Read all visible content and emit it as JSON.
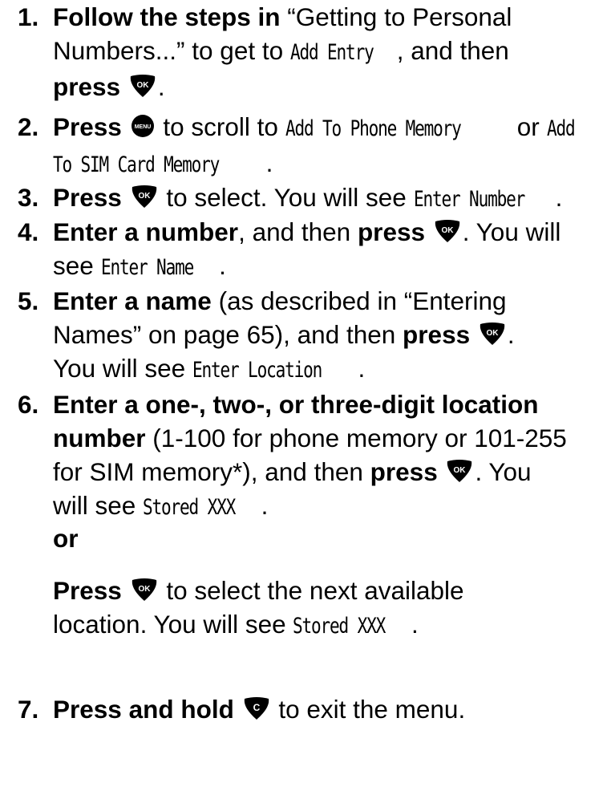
{
  "steps": [
    {
      "number": "1.",
      "lines": [
        [
          {
            "t": "bold",
            "v": "Follow the steps in"
          },
          {
            "t": "text",
            "v": " “Getting to Personal"
          }
        ],
        [
          {
            "t": "text",
            "v": "Numbers...” to get to "
          },
          {
            "t": "lcd",
            "v": "Add Entry"
          },
          {
            "t": "text",
            "v": ", and then"
          }
        ],
        [
          {
            "t": "bold",
            "v": "press "
          },
          {
            "t": "key",
            "v": "ok"
          },
          {
            "t": "text",
            "v": "."
          }
        ]
      ]
    },
    {
      "number": "2.",
      "lines": [
        [
          {
            "t": "bold",
            "v": "Press "
          },
          {
            "t": "key",
            "v": "menu"
          },
          {
            "t": "text",
            "v": " to scroll to "
          },
          {
            "t": "lcd",
            "v": "Add To Phone Memory"
          },
          {
            "t": "text",
            "v": " or "
          },
          {
            "t": "lcd",
            "v": "Add"
          }
        ],
        [
          {
            "t": "lcd",
            "v": "To SIM Card Memory"
          },
          {
            "t": "text",
            "v": "."
          }
        ]
      ]
    },
    {
      "number": "3.",
      "lines": [
        [
          {
            "t": "bold",
            "v": "Press "
          },
          {
            "t": "key",
            "v": "ok"
          },
          {
            "t": "text",
            "v": " to select. You will see "
          },
          {
            "t": "lcd",
            "v": "Enter Number"
          },
          {
            "t": "text",
            "v": "."
          }
        ]
      ]
    },
    {
      "number": "4.",
      "lines": [
        [
          {
            "t": "bold",
            "v": "Enter a number"
          },
          {
            "t": "text",
            "v": ", and then "
          },
          {
            "t": "bold",
            "v": "press "
          },
          {
            "t": "key",
            "v": "ok"
          },
          {
            "t": "text",
            "v": ". You will"
          }
        ],
        [
          {
            "t": "text",
            "v": "see "
          },
          {
            "t": "lcd",
            "v": "Enter Name"
          },
          {
            "t": "text",
            "v": "."
          }
        ]
      ]
    },
    {
      "number": "5.",
      "lines": [
        [
          {
            "t": "bold",
            "v": "Enter a name"
          },
          {
            "t": "text",
            "v": " (as described in “Entering"
          }
        ],
        [
          {
            "t": "text",
            "v": "Names” on page 65), and then "
          },
          {
            "t": "bold",
            "v": "press "
          },
          {
            "t": "key",
            "v": "ok"
          },
          {
            "t": "text",
            "v": "."
          }
        ],
        [
          {
            "t": "text",
            "v": "You will see "
          },
          {
            "t": "lcd",
            "v": "Enter Location"
          },
          {
            "t": "text",
            "v": "."
          }
        ]
      ]
    },
    {
      "number": "6.",
      "lines": [
        [
          {
            "t": "bold",
            "v": "Enter a one-, two-, or three-digit location"
          }
        ],
        [
          {
            "t": "bold",
            "v": "number"
          },
          {
            "t": "text",
            "v": " (1-100 for phone memory or 101-255"
          }
        ],
        [
          {
            "t": "text",
            "v": "for SIM memory*), and then "
          },
          {
            "t": "bold",
            "v": "press "
          },
          {
            "t": "key",
            "v": "ok"
          },
          {
            "t": "text",
            "v": ". You"
          }
        ],
        [
          {
            "t": "text",
            "v": "will see "
          },
          {
            "t": "lcd",
            "v": "Stored XXX"
          },
          {
            "t": "text",
            "v": "."
          }
        ]
      ]
    },
    {
      "number": "",
      "lines": [
        [
          {
            "t": "bold",
            "v": "or"
          }
        ]
      ]
    },
    {
      "number": "",
      "lines": [
        [
          {
            "t": "bold",
            "v": "Press "
          },
          {
            "t": "key",
            "v": "ok"
          },
          {
            "t": "text",
            "v": " to select the next available"
          }
        ],
        [
          {
            "t": "text",
            "v": "location. You will see "
          },
          {
            "t": "lcd",
            "v": "Stored XXX"
          },
          {
            "t": "text",
            "v": "."
          }
        ]
      ]
    },
    {
      "number": "7.",
      "lines": [
        [
          {
            "t": "bold",
            "v": "Press and hold "
          },
          {
            "t": "key",
            "v": "c"
          },
          {
            "t": "text",
            "v": " to exit the menu."
          }
        ]
      ]
    }
  ],
  "icons": {
    "ok": {
      "name": "ok-key-icon",
      "label": "OK"
    },
    "menu": {
      "name": "menu-key-icon",
      "label": "MENU"
    },
    "c": {
      "name": "c-key-icon",
      "label": "C"
    }
  }
}
